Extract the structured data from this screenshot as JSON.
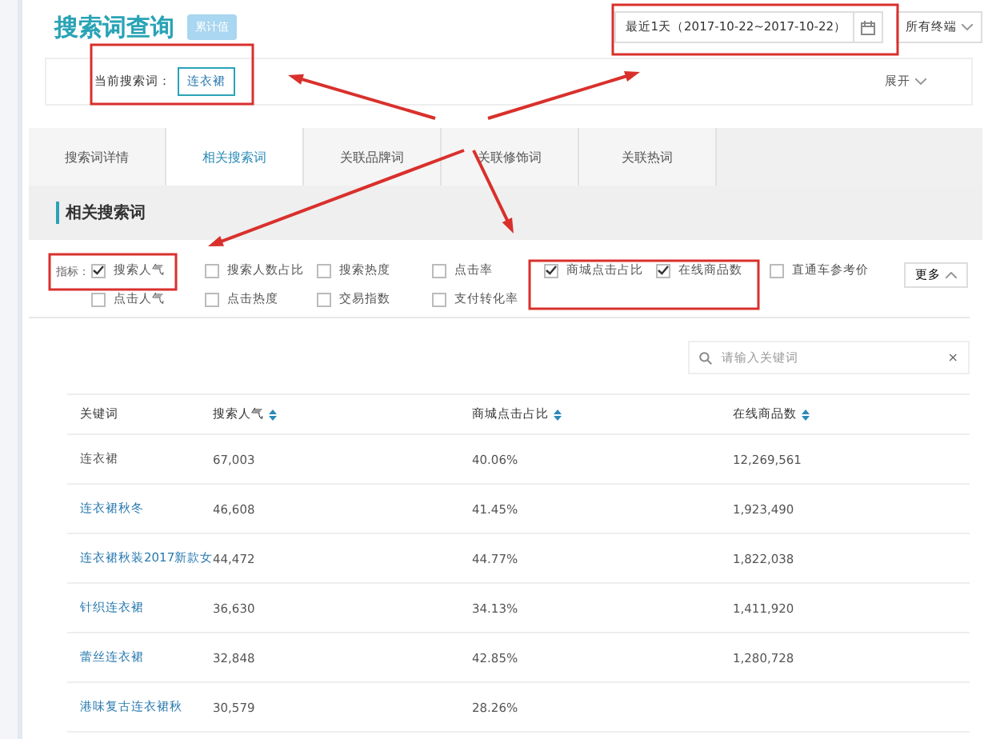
{
  "header": {
    "title": "搜索词查询",
    "badge": "累计值",
    "date_range": "最近1天（2017-10-22~2017-10-22）",
    "device_select": "所有终端"
  },
  "current_term": {
    "label": "当前搜索词：",
    "value": "连衣裙",
    "expand": "展开"
  },
  "tabs": [
    {
      "label": "搜索词详情",
      "selected": false
    },
    {
      "label": "相关搜索词",
      "selected": true
    },
    {
      "label": "关联品牌词",
      "selected": false
    },
    {
      "label": "关联修饰词",
      "selected": false
    },
    {
      "label": "关联热词",
      "selected": false
    }
  ],
  "section_title": "相关搜索词",
  "metrics": {
    "label": "指标：",
    "more": "更多",
    "items": [
      {
        "label": "搜索人气",
        "checked": true
      },
      {
        "label": "搜索人数占比",
        "checked": false
      },
      {
        "label": "搜索热度",
        "checked": false
      },
      {
        "label": "点击率",
        "checked": false
      },
      {
        "label": "商城点击占比",
        "checked": true
      },
      {
        "label": "在线商品数",
        "checked": true
      },
      {
        "label": "直通车参考价",
        "checked": false
      },
      {
        "label": "点击人气",
        "checked": false
      },
      {
        "label": "点击热度",
        "checked": false
      },
      {
        "label": "交易指数",
        "checked": false
      },
      {
        "label": "支付转化率",
        "checked": false
      }
    ]
  },
  "search": {
    "placeholder": "请输入关键词",
    "clear": "×"
  },
  "table": {
    "columns": [
      {
        "label": "关键词",
        "sortable": false
      },
      {
        "label": "搜索人气",
        "sortable": true
      },
      {
        "label": "商城点击占比",
        "sortable": true
      },
      {
        "label": "在线商品数",
        "sortable": true
      }
    ],
    "rows": [
      {
        "link": false,
        "cells": [
          "连衣裙",
          "67,003",
          "40.06%",
          "12,269,561"
        ]
      },
      {
        "link": true,
        "cells": [
          "连衣裙秋冬",
          "46,608",
          "41.45%",
          "1,923,490"
        ]
      },
      {
        "link": true,
        "cells": [
          "连衣裙秋装2017新款女",
          "44,472",
          "44.77%",
          "1,822,038"
        ]
      },
      {
        "link": true,
        "cells": [
          "针织连衣裙",
          "36,630",
          "34.13%",
          "1,411,920"
        ]
      },
      {
        "link": true,
        "cells": [
          "蕾丝连衣裙",
          "32,848",
          "42.85%",
          "1,280,728"
        ]
      },
      {
        "link": true,
        "cells": [
          "港味复古连衣裙秋",
          "30,579",
          "28.26%"
        ]
      }
    ]
  }
}
